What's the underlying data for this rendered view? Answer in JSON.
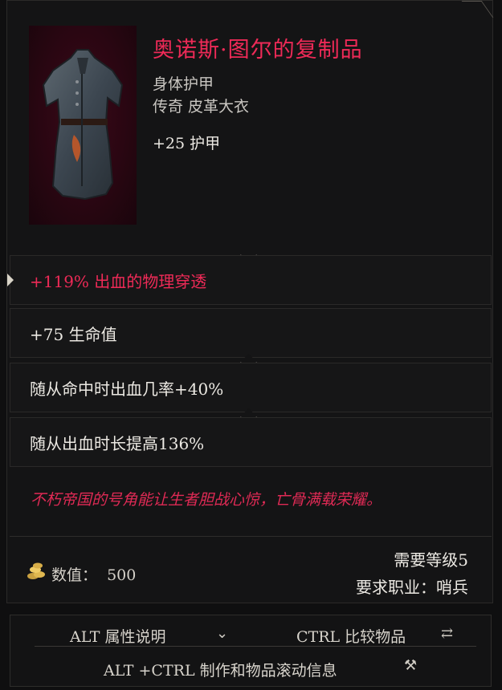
{
  "item": {
    "name": "奥诺斯·图尔的复制品",
    "slot": "身体护甲",
    "rarity_type": "传奇 皮革大衣",
    "base_stat": "+25 护甲"
  },
  "affixes": [
    {
      "text": "+119% 出血的物理穿透"
    },
    {
      "text": "+75 生命值"
    },
    {
      "text": "随从命中时出血几率+40%"
    },
    {
      "text": "随从出血时长提高136%"
    }
  ],
  "lore": "不朽帝国的号角能让生者胆战心惊，亡骨满载荣耀。",
  "value": {
    "label": "数值：",
    "amount": "500",
    "icon": "gold-coins-icon"
  },
  "requirements": {
    "level": "需要等级5",
    "class": "要求职业：哨兵"
  },
  "footer": {
    "alt_hint": "ALT 属性说明",
    "ctrl_hint": "CTRL 比较物品",
    "alt_ctrl_hint": "ALT +CTRL 制作和物品滚动信息"
  },
  "colors": {
    "legendary_text": "#ee2a57",
    "lore_text": "#e02a55",
    "normal_text": "#ece9e3",
    "panel_bg": "#141415"
  }
}
